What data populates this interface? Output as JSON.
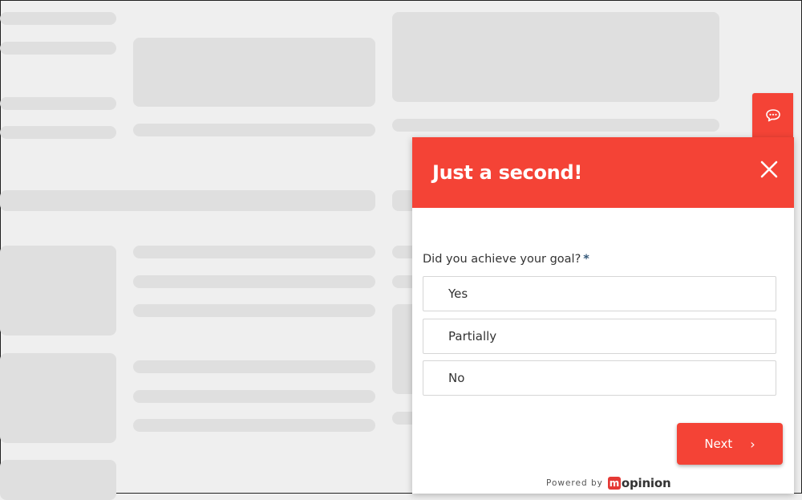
{
  "colors": {
    "accent": "#f44336",
    "background": "#efefef",
    "skeleton": "#dfdfdf"
  },
  "feedback_tab": {
    "icon": "chat-bubble-icon"
  },
  "survey": {
    "title": "Just a second!",
    "close_icon": "close-icon",
    "question": "Did you achieve your goal?",
    "required_mark": "*",
    "options": [
      "Yes",
      "Partially",
      "No"
    ],
    "next_label": "Next",
    "next_icon": "›",
    "powered_by": "Powered by",
    "brand_m": "m",
    "brand_rest": "opinion"
  }
}
